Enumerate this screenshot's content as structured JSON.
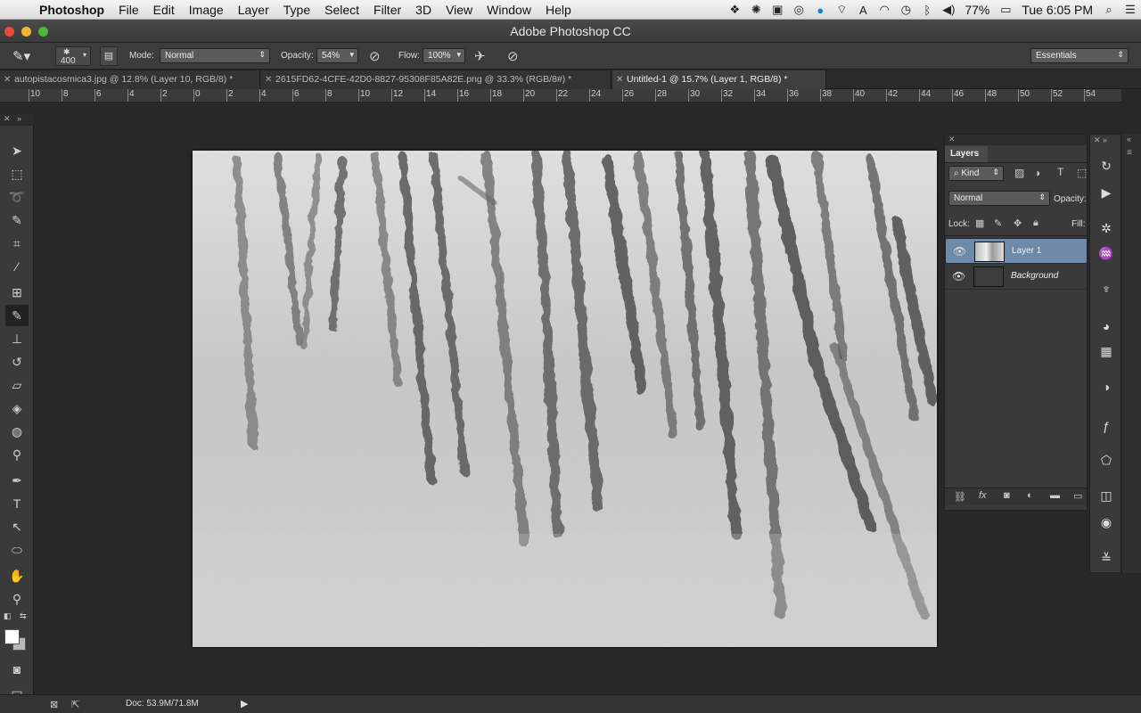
{
  "menubar": {
    "app": "Photoshop",
    "items": [
      "File",
      "Edit",
      "Image",
      "Layer",
      "Type",
      "Select",
      "Filter",
      "3D",
      "View",
      "Window",
      "Help"
    ],
    "battery": "77%",
    "clock": "Tue 6:05 PM"
  },
  "window": {
    "title": "Adobe Photoshop CC"
  },
  "options": {
    "brush_size": "400",
    "mode_label": "Mode:",
    "mode_value": "Normal",
    "opacity_label": "Opacity:",
    "opacity_value": "54%",
    "flow_label": "Flow:",
    "flow_value": "100%",
    "workspace": "Essentials"
  },
  "tabs": [
    {
      "label": "autopistacosmica3.jpg @ 12.8% (Layer 10, RGB/8) *"
    },
    {
      "label": "2615FD62-4CFE-42D0-8827-95308F85A82E.png @ 33.3% (RGB/8#) *"
    },
    {
      "label": "Untitled-1 @ 15.7% (Layer 1, RGB/8) *"
    }
  ],
  "ruler": [
    "10",
    "8",
    "6",
    "4",
    "2",
    "0",
    "2",
    "4",
    "6",
    "8",
    "10",
    "12",
    "14",
    "16",
    "18",
    "20",
    "22",
    "24",
    "26",
    "28",
    "30",
    "32",
    "34",
    "36",
    "38",
    "40",
    "42",
    "44",
    "46",
    "48",
    "50",
    "52",
    "54"
  ],
  "layers_panel": {
    "title": "Layers",
    "filter": "Kind",
    "blend_mode": "Normal",
    "opacity_label": "Opacity:",
    "lock_label": "Lock:",
    "fill_label": "Fill:",
    "layers": [
      {
        "name": "Layer 1",
        "selected": true
      },
      {
        "name": "Background",
        "selected": false
      }
    ]
  },
  "status": {
    "doc": "Doc: 53.9M/71.8M"
  },
  "colors": {
    "selection": "#6f8aa8",
    "panel": "#3a3a3a",
    "workspace": "#282828"
  }
}
